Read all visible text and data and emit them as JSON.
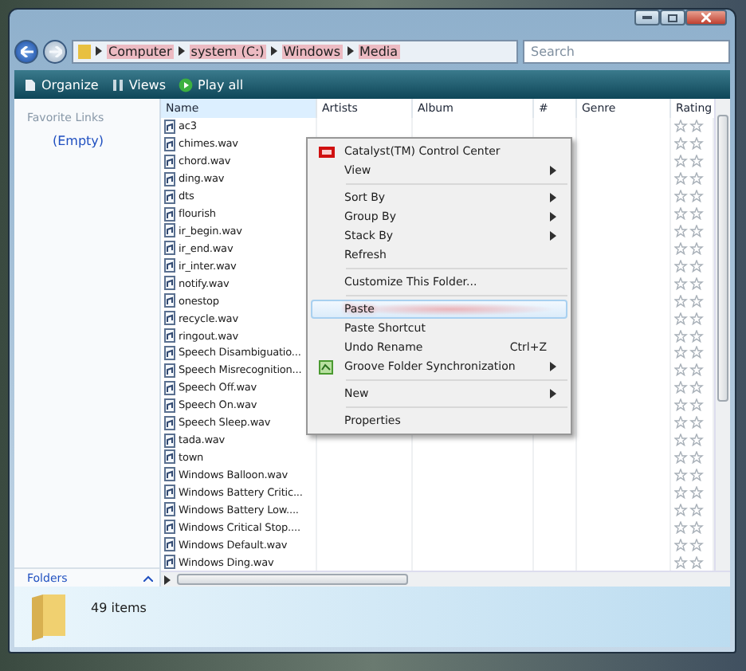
{
  "address": {
    "crumbs": [
      "Computer",
      "system (C:)",
      "Windows",
      "Media"
    ]
  },
  "search": {
    "placeholder": "Search"
  },
  "toolbar": [
    {
      "label": "Organize",
      "kind": "organize"
    },
    {
      "label": "Views",
      "kind": "views"
    },
    {
      "label": "Play all",
      "kind": "play"
    }
  ],
  "nav": {
    "heading": "Favorite Links",
    "items": [
      "(Empty)"
    ],
    "folders": "Folders"
  },
  "columns": [
    "Name",
    "Artists",
    "Album",
    "#",
    "Genre",
    "Rating"
  ],
  "files": [
    {
      "name": "ac3"
    },
    {
      "name": "chimes.wav"
    },
    {
      "name": "chord.wav"
    },
    {
      "name": "ding.wav"
    },
    {
      "name": "dts"
    },
    {
      "name": "flourish"
    },
    {
      "name": "ir_begin.wav"
    },
    {
      "name": "ir_end.wav"
    },
    {
      "name": "ir_inter.wav"
    },
    {
      "name": "notify.wav"
    },
    {
      "name": "onestop"
    },
    {
      "name": "recycle.wav"
    },
    {
      "name": "ringout.wav"
    },
    {
      "name": "Speech Disambiguatio..."
    },
    {
      "name": "Speech Misrecognition..."
    },
    {
      "name": "Speech Off.wav"
    },
    {
      "name": "Speech On.wav"
    },
    {
      "name": "Speech Sleep.wav"
    },
    {
      "name": "tada.wav"
    },
    {
      "name": "town"
    },
    {
      "name": "Windows Balloon.wav"
    },
    {
      "name": "Windows Battery Critic..."
    },
    {
      "name": "Windows Battery Low...."
    },
    {
      "name": "Windows Critical Stop...."
    },
    {
      "name": "Windows Default.wav"
    },
    {
      "name": "Windows Ding.wav"
    }
  ],
  "menu": [
    {
      "kind": "logo-item",
      "label": "Catalyst(TM) Control Center",
      "submenu": false,
      "selected": false
    },
    {
      "kind": "item",
      "label": "View",
      "submenu": true,
      "selected": false
    },
    {
      "kind": "separator"
    },
    {
      "kind": "item",
      "label": "Sort By",
      "submenu": true,
      "selected": false
    },
    {
      "kind": "item",
      "label": "Group By",
      "submenu": true,
      "selected": false
    },
    {
      "kind": "item",
      "label": "Stack By",
      "submenu": true,
      "selected": false
    },
    {
      "kind": "item",
      "label": "Refresh",
      "submenu": false,
      "selected": false
    },
    {
      "kind": "separator"
    },
    {
      "kind": "item",
      "label": "Customize This Folder...",
      "submenu": false,
      "selected": false
    },
    {
      "kind": "separator"
    },
    {
      "kind": "item",
      "label": "Paste",
      "submenu": false,
      "selected": true
    },
    {
      "kind": "item",
      "label": "Paste Shortcut",
      "submenu": false,
      "selected": false
    },
    {
      "kind": "item",
      "label": "Undo Rename",
      "shortcut": "Ctrl+Z",
      "submenu": false,
      "selected": false
    },
    {
      "kind": "sync-item",
      "label": "Groove Folder Synchronization",
      "submenu": true,
      "selected": false
    },
    {
      "kind": "separator"
    },
    {
      "kind": "item",
      "label": "New",
      "submenu": true,
      "selected": false
    },
    {
      "kind": "separator"
    },
    {
      "kind": "item",
      "label": "Properties",
      "submenu": false,
      "selected": false
    }
  ],
  "status": {
    "count": "49 items"
  }
}
